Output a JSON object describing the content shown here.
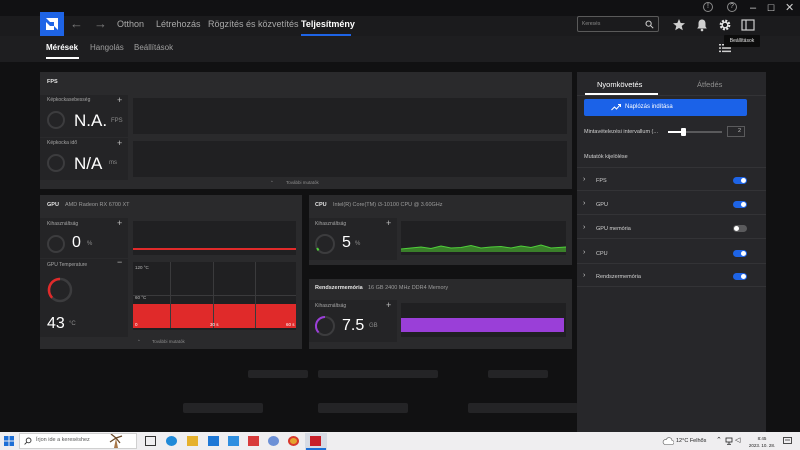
{
  "nav": {
    "links": [
      "Otthon",
      "Létrehozás",
      "Rögzítés és közvetítés",
      "Teljesítmény"
    ],
    "active": "Teljesítmény",
    "search_placeholder": "Keresés"
  },
  "subnav": {
    "tabs": [
      "Mérések",
      "Hangolás",
      "Beállítások"
    ],
    "active": "Mérések"
  },
  "tooltip": "Beállítások",
  "fps_panel": {
    "title": "FPS",
    "frame_rate_label": "Képkockasebesség",
    "frame_rate_value": "N.A.",
    "frame_rate_unit": "FPS",
    "frame_time_label": "Képkocka idő",
    "frame_time_value": "N/A",
    "frame_time_unit": "ms",
    "more_label": "További mutatók"
  },
  "gpu_panel": {
    "title": "GPU",
    "device": "AMD Radeon RX 6700 XT",
    "usage_label": "Kihasználtság",
    "usage_value": "0",
    "usage_unit": "%",
    "temp_label": "GPU Temperature",
    "temp_value": "43",
    "temp_unit": "°C",
    "temp_chart_top": "120 °C",
    "temp_chart_mid": "60 °C",
    "temp_x_ticks": [
      "0",
      "30 s",
      "60 s"
    ],
    "more_label": "További mutatók"
  },
  "cpu_panel": {
    "title": "CPU",
    "device": "Intel(R) Core(TM) i3-10100 CPU @ 3.60GHz",
    "usage_label": "Kihasználtság",
    "usage_value": "5",
    "usage_unit": "%"
  },
  "ram_panel": {
    "title": "Rendszermemória",
    "device": "16 GB 2400 MHz DDR4 Memory",
    "usage_label": "Kihasználtság",
    "usage_value": "7.5",
    "usage_unit": "GB"
  },
  "right_panel": {
    "tabs": [
      "Nyomkövetés",
      "Átfedés"
    ],
    "active_tab": "Nyomkövetés",
    "start_button": "Naplózás indítása",
    "sampling_label": "Mintavételezési intervallum (...",
    "sampling_value": "2",
    "sampling_fraction": 0.27,
    "metrics_header": "Mutatók kijelölése",
    "metrics": [
      {
        "label": "FPS",
        "on": true
      },
      {
        "label": "GPU",
        "on": true
      },
      {
        "label": "GPU memória",
        "on": false
      },
      {
        "label": "CPU",
        "on": true
      },
      {
        "label": "Rendszermemória",
        "on": true
      }
    ]
  },
  "taskbar": {
    "search_placeholder": "Írjon ide a kereséshez",
    "weather": "12°C  Felhős",
    "time": "8:45",
    "date": "2023. 10. 28."
  },
  "colors": {
    "accent": "#1e64e6",
    "gpu_red": "#e02a2a",
    "cpu_green": "#4fcf3a",
    "ram_purple": "#9a3fd8"
  }
}
